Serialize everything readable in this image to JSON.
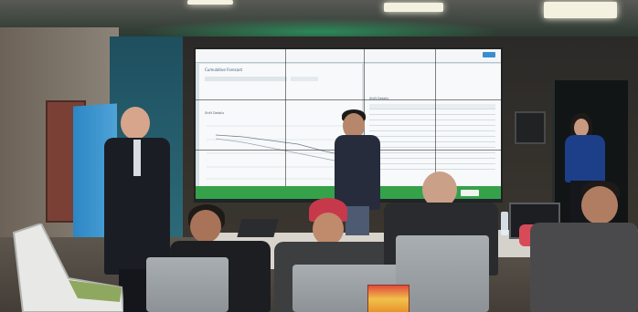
{
  "scene": {
    "description_label": "",
    "palette": {
      "wall_teal": "#1e4f5f",
      "screen_bg": "#d9e2e6",
      "screen_green_bar": "#35a24a",
      "blue_panel": "#2d86c4",
      "cap_red": "#c7394a"
    }
  },
  "video_wall": {
    "app_title": "",
    "panel_title": "Cumulative Forecast",
    "chart_title": "Shift Details",
    "table_title": "Shift Details",
    "green_bar_text": "",
    "rows": 12
  }
}
